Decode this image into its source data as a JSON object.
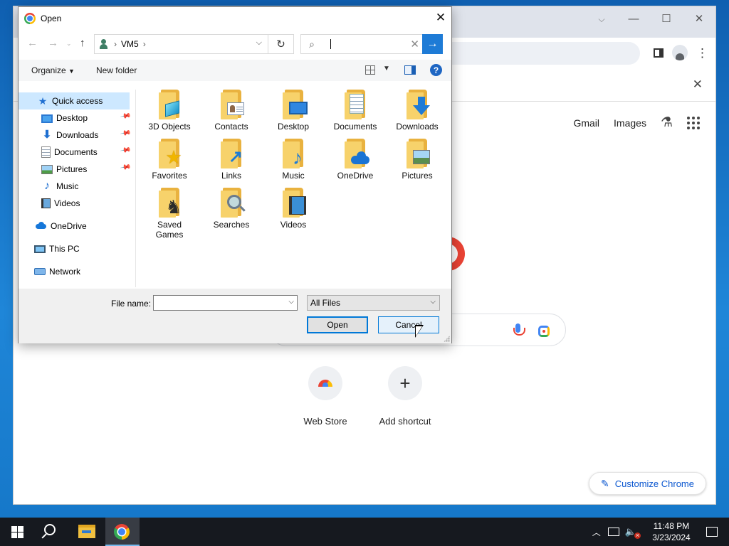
{
  "dialog": {
    "title": "Open",
    "breadcrumb": [
      "VM5"
    ],
    "search": {
      "value": "",
      "placeholder": ""
    },
    "commands": {
      "organize": "Organize",
      "new_folder": "New folder",
      "help": "?"
    },
    "nav_pane": {
      "quick_access": "Quick access",
      "pinned": [
        "Desktop",
        "Downloads",
        "Documents",
        "Pictures"
      ],
      "unpinned": [
        "Music",
        "Videos"
      ],
      "onedrive": "OneDrive",
      "this_pc": "This PC",
      "network": "Network"
    },
    "items": [
      {
        "label": "3D Objects",
        "icon": "3d-objects-folder-icon"
      },
      {
        "label": "Contacts",
        "icon": "contacts-folder-icon"
      },
      {
        "label": "Desktop",
        "icon": "desktop-folder-icon"
      },
      {
        "label": "Documents",
        "icon": "documents-folder-icon"
      },
      {
        "label": "Downloads",
        "icon": "downloads-folder-icon"
      },
      {
        "label": "Favorites",
        "icon": "favorites-folder-icon"
      },
      {
        "label": "Links",
        "icon": "links-folder-icon"
      },
      {
        "label": "Music",
        "icon": "music-folder-icon"
      },
      {
        "label": "OneDrive",
        "icon": "onedrive-folder-icon"
      },
      {
        "label": "Pictures",
        "icon": "pictures-folder-icon"
      },
      {
        "label": "Saved Games",
        "label_lines": [
          "Saved",
          "Games"
        ],
        "icon": "saved-games-folder-icon"
      },
      {
        "label": "Searches",
        "icon": "searches-folder-icon"
      },
      {
        "label": "Videos",
        "icon": "videos-folder-icon"
      }
    ],
    "file_name": {
      "label": "File name:",
      "value": ""
    },
    "file_type": {
      "selected": "All Files"
    },
    "buttons": {
      "open": "Open",
      "cancel": "Cancel"
    }
  },
  "browser": {
    "google_links": {
      "gmail": "Gmail",
      "images": "Images"
    },
    "shortcuts": [
      {
        "label": "Web Store"
      },
      {
        "label": "Add shortcut",
        "glyph": "+"
      }
    ],
    "customize": "Customize Chrome"
  },
  "taskbar": {
    "time": "11:48 PM",
    "date": "3/23/2024"
  },
  "colors": {
    "accent": "#0078d7",
    "selection": "#cde8ff",
    "folder": "#f7d26b",
    "taskbar": "#16191f"
  }
}
